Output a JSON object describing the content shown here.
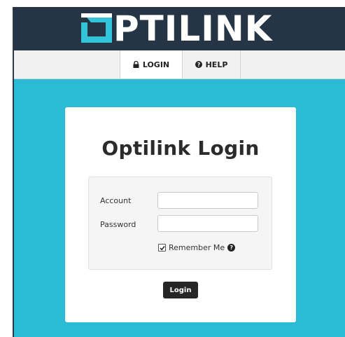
{
  "brand": {
    "logo_text": "PTILINK",
    "logo_icon": "optilink-o-logo-icon",
    "header_color": "#263545",
    "accent_color": "#33c4dc"
  },
  "nav": {
    "tabs": [
      {
        "label": "LOGIN",
        "icon": "lock-icon"
      },
      {
        "label": "HELP",
        "icon": "question-circle-icon"
      }
    ]
  },
  "login": {
    "title": "Optilink Login",
    "account_label": "Account",
    "account_value": "",
    "password_label": "Password",
    "password_value": "",
    "remember_label": "Remember Me",
    "remember_checked": true,
    "help_icon": "question-circle-icon",
    "submit_label": "Login"
  },
  "page": {
    "background_color": "#2cbbd5"
  }
}
